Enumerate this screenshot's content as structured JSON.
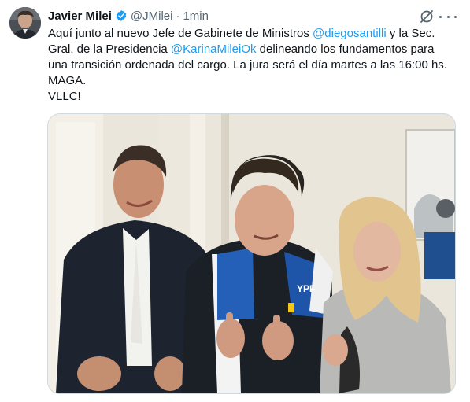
{
  "author": {
    "name": "Javier Milei",
    "handle": "@JMilei",
    "separator": "·",
    "time": "1min",
    "verified_color": "#1d9bf0"
  },
  "tweet": {
    "lines": [
      {
        "parts": [
          {
            "text": "Aquí junto al nuevo Jefe de Gabinete de Ministros ",
            "mention": false
          },
          {
            "text": "@diegosantilli",
            "mention": true
          },
          {
            "text": " y la Sec.",
            "mention": false
          }
        ]
      },
      {
        "parts": [
          {
            "text": "Gral. de la Presidencia ",
            "mention": false
          },
          {
            "text": "@KarinaMileiOk",
            "mention": true
          },
          {
            "text": " delineando los fundamentos para",
            "mention": false
          }
        ]
      },
      {
        "parts": [
          {
            "text": "una transición ordenada del cargo. La jura será el día martes a las 16:00 hs.",
            "mention": false
          }
        ]
      },
      {
        "parts": [
          {
            "text": "MAGA.",
            "mention": false
          }
        ]
      },
      {
        "parts": [
          {
            "text": "VLLC!",
            "mention": false
          }
        ]
      }
    ]
  },
  "media": {
    "jacket_logo_text": "YPF"
  },
  "colors": {
    "mention": "#1d9bf0",
    "secondary_text": "#536471",
    "border": "#cfd9de"
  },
  "icons": {
    "verified": "verified-badge-icon",
    "grok": "grok-icon",
    "more": "more-options-icon"
  }
}
